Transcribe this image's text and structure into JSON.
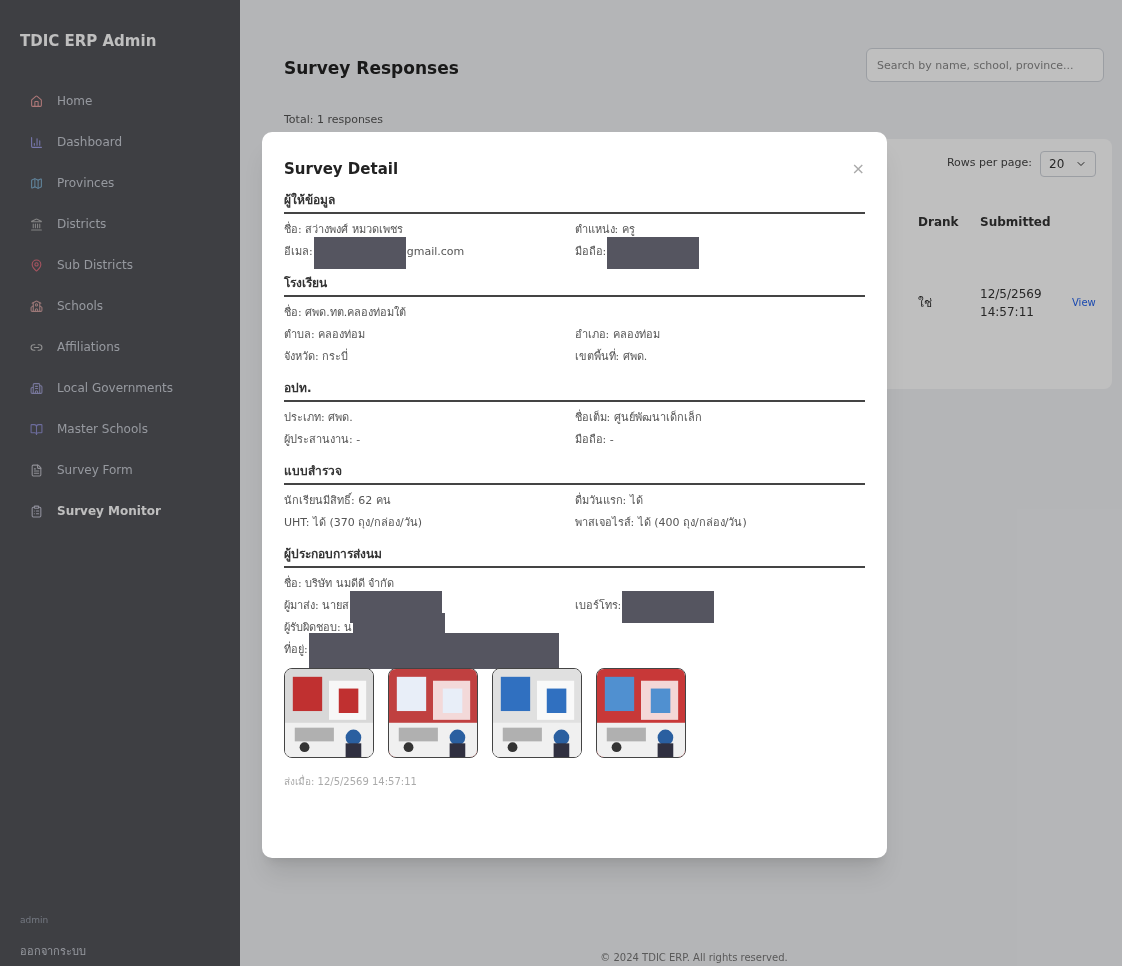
{
  "sidebar": {
    "title": "TDIC ERP Admin",
    "items": [
      {
        "label": "Home",
        "selected": false
      },
      {
        "label": "Dashboard",
        "selected": false
      },
      {
        "label": "Provinces",
        "selected": false
      },
      {
        "label": "Districts",
        "selected": false
      },
      {
        "label": "Sub Districts",
        "selected": false
      },
      {
        "label": "Schools",
        "selected": false
      },
      {
        "label": "Affiliations",
        "selected": false
      },
      {
        "label": "Local Governments",
        "selected": false
      },
      {
        "label": "Master Schools",
        "selected": false
      },
      {
        "label": "Survey Form",
        "selected": false
      },
      {
        "label": "Survey Monitor",
        "selected": true
      }
    ],
    "user": "admin",
    "logout": "ออกจากระบบ"
  },
  "page": {
    "title": "Survey Responses",
    "search": {
      "placeholder": "Search by name, school, province..."
    },
    "total": "Total: 1 responses",
    "rows_per_page": {
      "label": "Rows per page:",
      "value": "20"
    },
    "table": {
      "columns": [
        "Drank",
        "Submitted"
      ],
      "rows": [
        {
          "cells": [
            "ใช่",
            "12/5/2569 14:57:11"
          ],
          "action": "View"
        }
      ]
    },
    "footer": "© 2024 TDIC ERP. All rights reserved."
  },
  "modal": {
    "title": "Survey Detail",
    "close": "×",
    "sections": [
      {
        "title": "ผู้ให้ข้อมูล",
        "rows": [
          [
            [
              {
                "kind": "text",
                "text": "ชื่อ: สว่างพงศ์ หมวดเพชร"
              }
            ],
            [
              {
                "kind": "text",
                "text": "ตำแหน่ง: ครู"
              }
            ]
          ],
          [
            [
              {
                "kind": "text",
                "text": "อีเมล:"
              },
              {
                "kind": "redacted"
              },
              {
                "kind": "text",
                "text": "gmail.com"
              }
            ],
            [
              {
                "kind": "text",
                "text": "มือถือ:"
              },
              {
                "kind": "redacted"
              }
            ]
          ]
        ]
      },
      {
        "title": "โรงเรียน",
        "rows": [
          [
            [
              {
                "kind": "text",
                "text": "ชื่อ: ศพด.ทต.คลองท่อมใต้"
              }
            ]
          ],
          [
            [
              {
                "kind": "text",
                "text": "ตำบล: คลองท่อม"
              }
            ],
            [
              {
                "kind": "text",
                "text": "อำเภอ: คลองท่อม"
              }
            ]
          ],
          [
            [
              {
                "kind": "text",
                "text": "จังหวัด: กระบี่"
              }
            ],
            [
              {
                "kind": "text",
                "text": "เขตพื้นที่: ศพด."
              }
            ]
          ]
        ]
      },
      {
        "title": "อปท.",
        "rows": [
          [
            [
              {
                "kind": "text",
                "text": "ประเภท: ศพด."
              }
            ],
            [
              {
                "kind": "text",
                "text": "ชื่อเต็ม: ศูนย์พัฒนาเด็กเล็ก"
              }
            ]
          ],
          [
            [
              {
                "kind": "text",
                "text": "ผู้ประสานงาน: -"
              }
            ],
            [
              {
                "kind": "text",
                "text": "มือถือ: -"
              }
            ]
          ]
        ]
      },
      {
        "title": "แบบสำรวจ",
        "rows": [
          [
            [
              {
                "kind": "text",
                "text": "นักเรียนมีสิทธิ์: 62 คน"
              }
            ],
            [
              {
                "kind": "text",
                "text": "ดื่มวันแรก: ได้"
              }
            ]
          ],
          [
            [
              {
                "kind": "text",
                "text": "UHT: ได้ (370 ถุง/กล่อง/วัน)"
              }
            ],
            [
              {
                "kind": "text",
                "text": "พาสเจอไรส์: ได้ (400 ถุง/กล่อง/วัน)"
              }
            ]
          ]
        ]
      },
      {
        "title": "ผู้ประกอบการส่งนม",
        "rows": [
          [
            [
              {
                "kind": "text",
                "text": "ชื่อ: บริษัท นมดีดี จำกัด"
              }
            ]
          ],
          [
            [
              {
                "kind": "text",
                "text": "ผู้มาส่ง: นายส"
              },
              {
                "kind": "redacted"
              }
            ],
            [
              {
                "kind": "text",
                "text": "เบอร์โทร:"
              },
              {
                "kind": "redacted"
              }
            ]
          ],
          [
            [
              {
                "kind": "text",
                "text": "ผู้รับผิดชอบ: น"
              },
              {
                "kind": "redacted"
              }
            ]
          ],
          [
            [
              {
                "kind": "text",
                "text": "ที่อยู่:"
              },
              {
                "kind": "redacted_wide"
              }
            ]
          ]
        ]
      }
    ],
    "submitted": "ส่งเมื่อ: 12/5/2569 14:57:11"
  }
}
